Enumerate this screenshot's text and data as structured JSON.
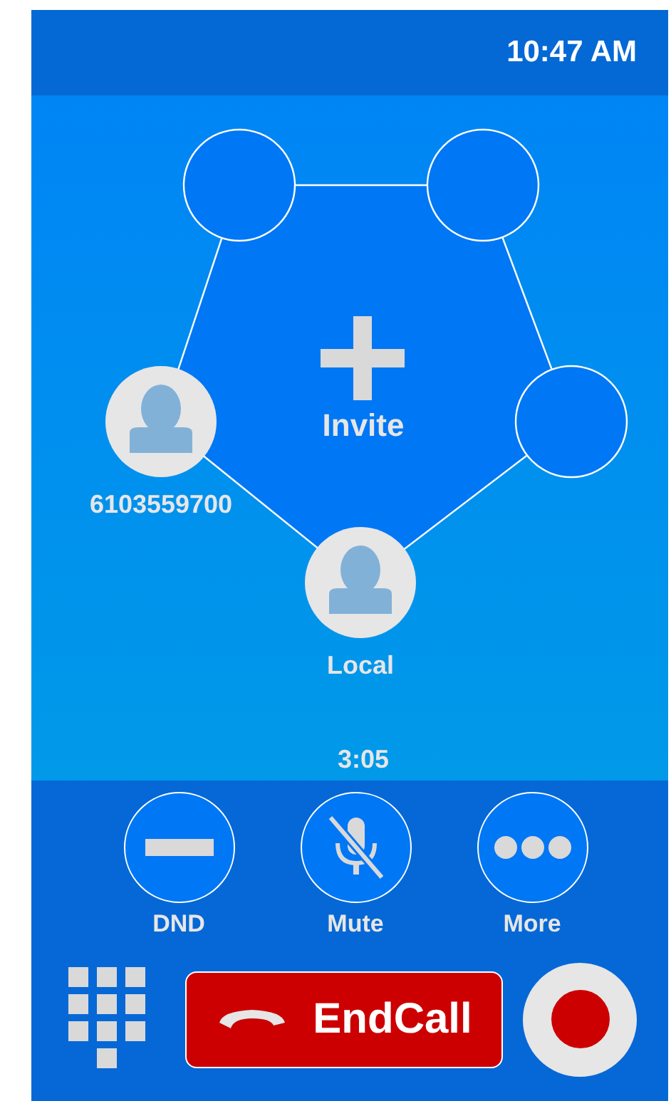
{
  "status_bar": {
    "time": "10:47 AM"
  },
  "conference": {
    "slots": [
      {
        "kind": "empty"
      },
      {
        "kind": "empty"
      },
      {
        "kind": "participant",
        "name": "6103559700"
      },
      {
        "kind": "empty"
      },
      {
        "kind": "participant",
        "name": "Local"
      }
    ],
    "invite_label": "Invite",
    "duration": "3:05"
  },
  "actions": [
    {
      "kind": "dnd",
      "label": "DND"
    },
    {
      "kind": "mute",
      "label": "Mute"
    },
    {
      "kind": "more",
      "label": "More"
    }
  ],
  "end_call": {
    "label": "EndCall"
  }
}
